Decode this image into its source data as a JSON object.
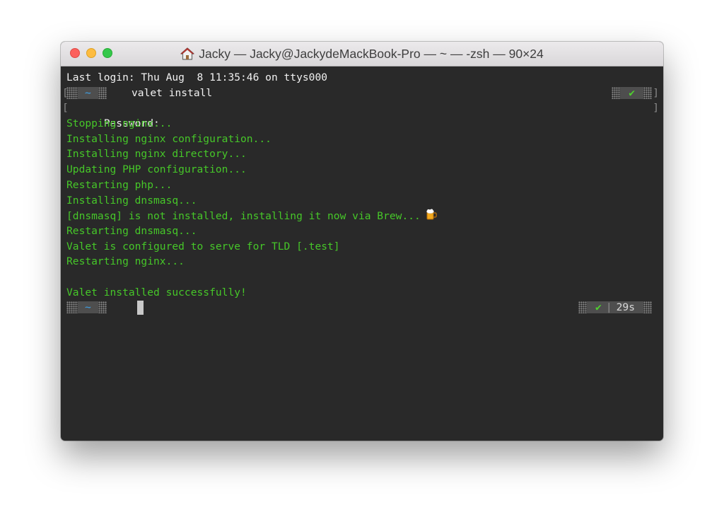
{
  "window": {
    "title": "Jacky — Jacky@JackydeMackBook-Pro — ~ — -zsh — 90×24",
    "title_icon": "home-icon"
  },
  "terminal": {
    "last_login": "Last login: Thu Aug  8 11:35:46 on ttys000",
    "prompt_dir": "~",
    "command": "valet install",
    "status_ok": "✔",
    "password_line": "Password:",
    "output": [
      "Stopping nginx...",
      "Installing nginx configuration...",
      "Installing nginx directory...",
      "Updating PHP configuration...",
      "Restarting php...",
      "Installing dnsmasq...",
      "[dnsmasq] is not installed, installing it now via Brew...",
      "Restarting dnsmasq...",
      "Valet is configured to serve for TLD [.test]",
      "Restarting nginx...",
      "",
      "Valet installed successfully!"
    ],
    "brew_icon": "beer-mug-icon",
    "final_prompt_dir": "~",
    "final_status_ok": "✔",
    "final_status_sep": "|",
    "final_status_time": "29s"
  },
  "colors": {
    "terminal_bg": "#292929",
    "output_green": "#46c729",
    "prompt_blue": "#3fa2e8"
  }
}
